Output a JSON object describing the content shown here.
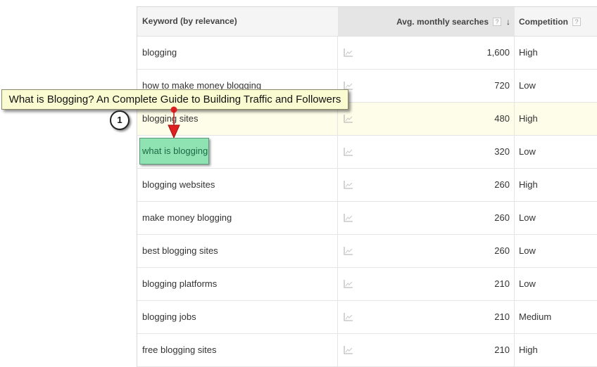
{
  "table": {
    "headers": {
      "keyword": "Keyword (by relevance)",
      "avg_searches": "Avg. monthly searches",
      "competition": "Competition",
      "help_glyph": "?",
      "sort_glyph": "↓"
    },
    "rows": [
      {
        "keyword": "blogging",
        "searches": "1,600",
        "competition": "High"
      },
      {
        "keyword": "how to make money blogging",
        "searches": "720",
        "competition": "Low"
      },
      {
        "keyword": "blogging sites",
        "searches": "480",
        "competition": "High"
      },
      {
        "keyword": "what is blogging",
        "searches": "320",
        "competition": "Low"
      },
      {
        "keyword": "blogging websites",
        "searches": "260",
        "competition": "High"
      },
      {
        "keyword": "make money blogging",
        "searches": "260",
        "competition": "Low"
      },
      {
        "keyword": "best blogging sites",
        "searches": "260",
        "competition": "Low"
      },
      {
        "keyword": "blogging platforms",
        "searches": "210",
        "competition": "Low"
      },
      {
        "keyword": "blogging jobs",
        "searches": "210",
        "competition": "Medium"
      },
      {
        "keyword": "free blogging sites",
        "searches": "210",
        "competition": "High"
      }
    ]
  },
  "annotation": {
    "callout_text": "What is Blogging? An Complete Guide to Building Traffic and Followers",
    "step_number": "1",
    "highlight_text": "what is blogging",
    "colors": {
      "callout_bg": "#fbfbd2",
      "highlight_bg": "#8fe3b2",
      "arrow": "#e02020"
    }
  }
}
